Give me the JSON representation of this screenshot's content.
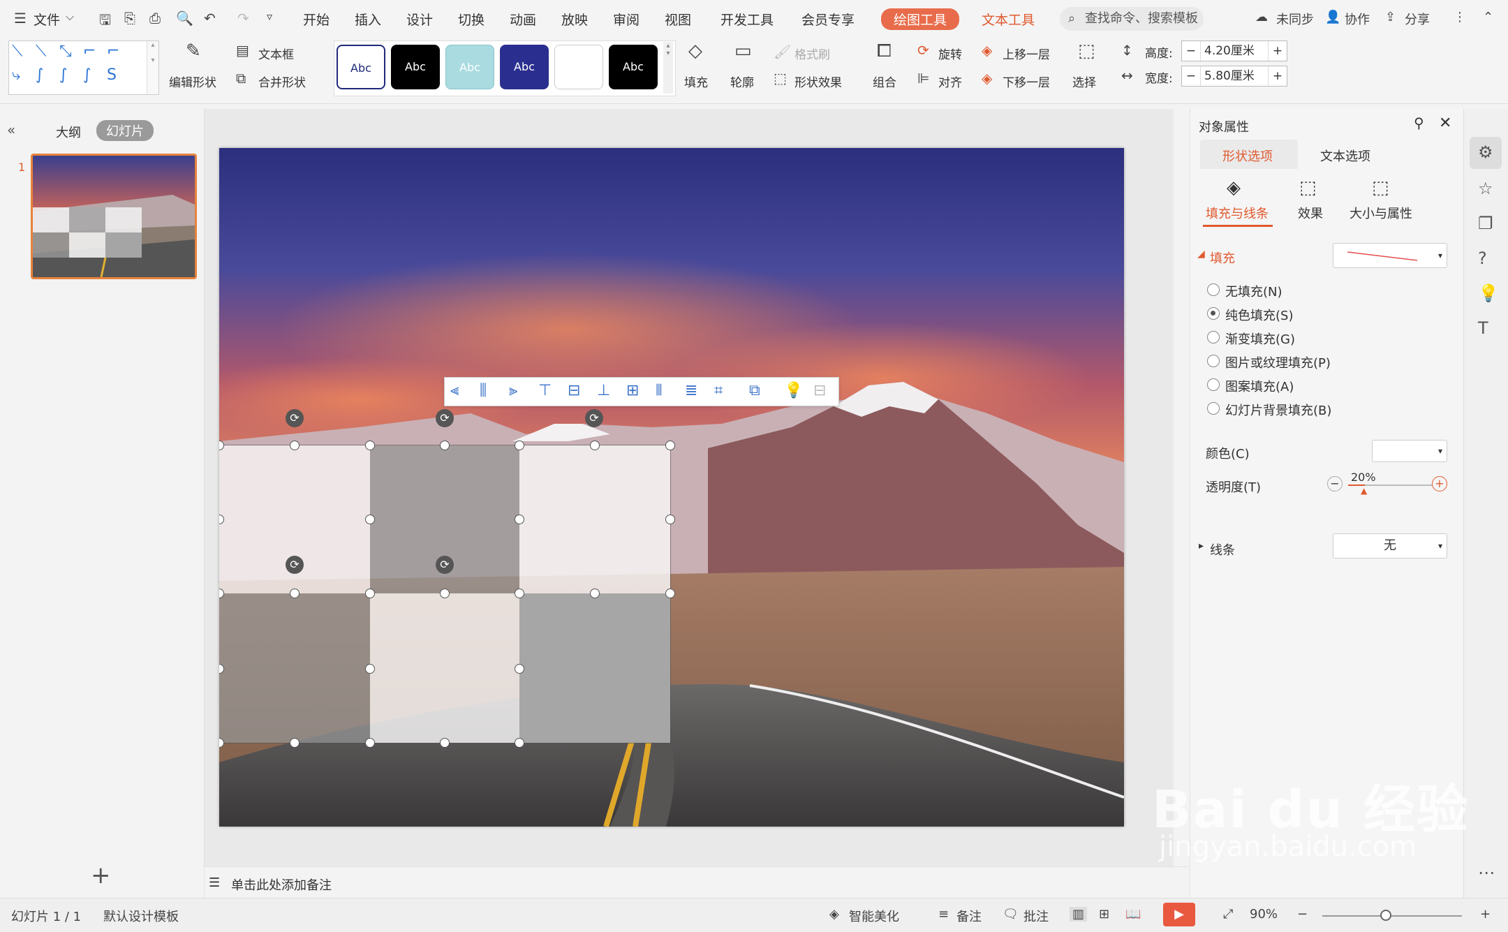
{
  "menubar": {
    "file_label": "文件",
    "tabs": [
      "开始",
      "插入",
      "设计",
      "切换",
      "动画",
      "放映",
      "审阅",
      "视图",
      "开发工具",
      "会员专享"
    ],
    "active_tab": "绘图工具",
    "text_tool": "文本工具",
    "search_placeholder": "查找命令、搜索模板",
    "sync": "未同步",
    "collab": "协作",
    "share": "分享"
  },
  "ribbon": {
    "edit_shape": "编辑形状",
    "text_box": "文本框",
    "merge_shape": "合并形状",
    "style_swatches": [
      "Abc",
      "Abc",
      "Abc",
      "Abc",
      "",
      "Abc"
    ],
    "fill": "填充",
    "outline": "轮廓",
    "format_painter": "格式刷",
    "shape_effect": "形状效果",
    "group": "组合",
    "rotate": "旋转",
    "align": "对齐",
    "bring_forward": "上移一层",
    "send_backward": "下移一层",
    "select": "选择",
    "height_label": "高度:",
    "height_value": "4.20厘米",
    "width_label": "宽度:",
    "width_value": "5.80厘米"
  },
  "leftpanel": {
    "outline_tab": "大纲",
    "slides_tab": "幻灯片",
    "slide_number": "1"
  },
  "notes_placeholder": "单击此处添加备注",
  "rightpanel": {
    "title": "对象属性",
    "tab_shape": "形状选项",
    "tab_text": "文本选项",
    "sub_fill_line": "填充与线条",
    "sub_effect": "效果",
    "sub_size": "大小与属性",
    "fill_section": "填充",
    "fill_options": [
      "无填充(N)",
      "纯色填充(S)",
      "渐变填充(G)",
      "图片或纹理填充(P)",
      "图案填充(A)",
      "幻灯片背景填充(B)"
    ],
    "selected_fill": 1,
    "color_label": "颜色(C)",
    "transparency_label": "透明度(T)",
    "transparency_value": "20%",
    "line_section": "线条",
    "line_value": "无"
  },
  "statusbar": {
    "slide_info": "幻灯片 1 / 1",
    "template": "默认设计模板",
    "smart_beautify": "智能美化",
    "notes": "备注",
    "comments": "批注",
    "zoom": "90%"
  },
  "watermark": {
    "brand": "Bai du 经验",
    "url": "jingyan.baidu.com"
  },
  "colors": {
    "accent": "#e86c4b",
    "selection_handle": "#555555",
    "tab_active": "#e0592f"
  }
}
